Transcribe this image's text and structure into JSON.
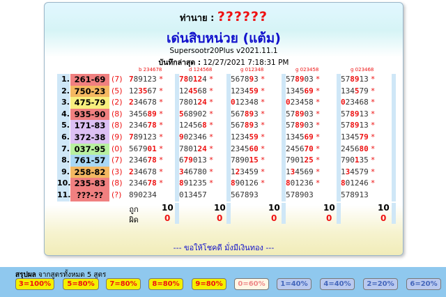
{
  "header": {
    "prophet_label": "ท่านาย :",
    "prophet_name": "??????",
    "title": "เด่นสิบหน่วย (แต้ม)",
    "version": "Supersootr20Plus v2021.11.1",
    "saved_label": "บันทึกล่าสุด :",
    "saved_value": "12/27/2021 7:18:31 PM"
  },
  "col_headers": [
    "b 234678",
    "d 124568",
    "g 012348",
    "g 023458",
    "g 023468"
  ],
  "colors": {
    "red": "#ee1111",
    "blue": "#1111cc",
    "pair_red": "#f08080",
    "pair_orange": "#f4b861",
    "pair_yellow": "#f8ef7e",
    "pair_purple": "#dcc0f4",
    "pair_green": "#b8f0a0",
    "pair_blue": "#a9d8f4"
  },
  "rows": [
    {
      "n": "1.",
      "pair": "261-69",
      "cnt": "(7)",
      "color": "#f08080",
      "sets": [
        [
          {
            "t": "7",
            "h": 1
          },
          {
            "t": "89123",
            "h": 0
          }
        ],
        [
          {
            "t": "78",
            "h": 1
          },
          {
            "t": "0",
            "h": 0
          },
          {
            "t": "12",
            "h": 1
          },
          {
            "t": "4",
            "h": 0
          }
        ],
        [
          {
            "t": "5678",
            "h": 0
          },
          {
            "t": "9",
            "h": 1
          },
          {
            "t": "3",
            "h": 0
          }
        ],
        [
          {
            "t": "57",
            "h": 0
          },
          {
            "t": "89",
            "h": 1
          },
          {
            "t": "03",
            "h": 0
          }
        ],
        [
          {
            "t": "57",
            "h": 0
          },
          {
            "t": "89",
            "h": 1
          },
          {
            "t": "13",
            "h": 0
          }
        ]
      ]
    },
    {
      "n": "2.",
      "pair": "750-23",
      "cnt": "(5)",
      "color": "#f4b861",
      "sets": [
        [
          {
            "t": "12",
            "h": 0
          },
          {
            "t": "35",
            "h": 1
          },
          {
            "t": "67",
            "h": 0
          }
        ],
        [
          {
            "t": "12",
            "h": 0
          },
          {
            "t": "45",
            "h": 1
          },
          {
            "t": "68",
            "h": 0
          }
        ],
        [
          {
            "t": "1234",
            "h": 0
          },
          {
            "t": "59",
            "h": 1
          }
        ],
        [
          {
            "t": "1345",
            "h": 0
          },
          {
            "t": "69",
            "h": 1
          }
        ],
        [
          {
            "t": "134",
            "h": 0
          },
          {
            "t": "5",
            "h": 1
          },
          {
            "t": "79",
            "h": 0
          }
        ]
      ]
    },
    {
      "n": "3.",
      "pair": "475-79",
      "cnt": "(2)",
      "color": "#f8ef7e",
      "sets": [
        [
          {
            "t": "2",
            "h": 1
          },
          {
            "t": "34678",
            "h": 0
          }
        ],
        [
          {
            "t": "7801",
            "h": 0
          },
          {
            "t": "24",
            "h": 1
          }
        ],
        [
          {
            "t": "0",
            "h": 1
          },
          {
            "t": "12348",
            "h": 0
          }
        ],
        [
          {
            "t": "0",
            "h": 1
          },
          {
            "t": "23458",
            "h": 0
          }
        ],
        [
          {
            "t": "0",
            "h": 1
          },
          {
            "t": "23468",
            "h": 0
          }
        ]
      ]
    },
    {
      "n": "4.",
      "pair": "935-90",
      "cnt": "(8)",
      "color": "#f08080",
      "sets": [
        [
          {
            "t": "3456",
            "h": 0
          },
          {
            "t": "89",
            "h": 1
          }
        ],
        [
          {
            "t": "5",
            "h": 1
          },
          {
            "t": "68902",
            "h": 0
          }
        ],
        [
          {
            "t": "567",
            "h": 0
          },
          {
            "t": "89",
            "h": 1
          },
          {
            "t": "3",
            "h": 0
          }
        ],
        [
          {
            "t": "57",
            "h": 0
          },
          {
            "t": "89",
            "h": 1
          },
          {
            "t": "03",
            "h": 0
          }
        ],
        [
          {
            "t": "57",
            "h": 0
          },
          {
            "t": "89",
            "h": 1
          },
          {
            "t": "13",
            "h": 0
          }
        ]
      ]
    },
    {
      "n": "5.",
      "pair": "171-83",
      "cnt": "(8)",
      "color": "#dcc0f4",
      "sets": [
        [
          {
            "t": "2346",
            "h": 0
          },
          {
            "t": "78",
            "h": 1
          }
        ],
        [
          {
            "t": "12456",
            "h": 0
          },
          {
            "t": "8",
            "h": 1
          }
        ],
        [
          {
            "t": "567",
            "h": 0
          },
          {
            "t": "89",
            "h": 1
          },
          {
            "t": "3",
            "h": 0
          }
        ],
        [
          {
            "t": "57",
            "h": 0
          },
          {
            "t": "89",
            "h": 1
          },
          {
            "t": "03",
            "h": 0
          }
        ],
        [
          {
            "t": "57",
            "h": 0
          },
          {
            "t": "89",
            "h": 1
          },
          {
            "t": "13",
            "h": 0
          }
        ]
      ]
    },
    {
      "n": "6.",
      "pair": "372-38",
      "cnt": "(9)",
      "color": "#dcc0f4",
      "sets": [
        [
          {
            "t": "7",
            "h": 1
          },
          {
            "t": "89123",
            "h": 0
          }
        ],
        [
          {
            "t": "9",
            "h": 1
          },
          {
            "t": "02346",
            "h": 0
          }
        ],
        [
          {
            "t": "1234",
            "h": 0
          },
          {
            "t": "59",
            "h": 1
          }
        ],
        [
          {
            "t": "1345",
            "h": 0
          },
          {
            "t": "69",
            "h": 1
          }
        ],
        [
          {
            "t": "1345",
            "h": 0
          },
          {
            "t": "79",
            "h": 1
          }
        ]
      ]
    },
    {
      "n": "7.",
      "pair": "037-95",
      "cnt": "(0)",
      "color": "#b8f0a0",
      "sets": [
        [
          {
            "t": "5679",
            "h": 0
          },
          {
            "t": "01",
            "h": 1
          }
        ],
        [
          {
            "t": "7801",
            "h": 0
          },
          {
            "t": "24",
            "h": 1
          }
        ],
        [
          {
            "t": "2345",
            "h": 0
          },
          {
            "t": "60",
            "h": 1
          }
        ],
        [
          {
            "t": "2456",
            "h": 0
          },
          {
            "t": "70",
            "h": 1
          }
        ],
        [
          {
            "t": "2456",
            "h": 0
          },
          {
            "t": "80",
            "h": 1
          }
        ]
      ]
    },
    {
      "n": "8.",
      "pair": "761-57",
      "cnt": "(7)",
      "color": "#a9d8f4",
      "sets": [
        [
          {
            "t": "2346",
            "h": 0
          },
          {
            "t": "78",
            "h": 1
          }
        ],
        [
          {
            "t": "6",
            "h": 0
          },
          {
            "t": "79",
            "h": 1
          },
          {
            "t": "013",
            "h": 0
          }
        ],
        [
          {
            "t": "7890",
            "h": 0
          },
          {
            "t": "15",
            "h": 1
          }
        ],
        [
          {
            "t": "7901",
            "h": 0
          },
          {
            "t": "25",
            "h": 1
          }
        ],
        [
          {
            "t": "790",
            "h": 0
          },
          {
            "t": "1",
            "h": 1
          },
          {
            "t": "35",
            "h": 0
          }
        ]
      ]
    },
    {
      "n": "9.",
      "pair": "258-82",
      "cnt": "(3)",
      "color": "#f4b861",
      "sets": [
        [
          {
            "t": "2",
            "h": 1
          },
          {
            "t": "34678",
            "h": 0
          }
        ],
        [
          {
            "t": "3",
            "h": 1
          },
          {
            "t": "46780",
            "h": 0
          }
        ],
        [
          {
            "t": "1",
            "h": 0
          },
          {
            "t": "2",
            "h": 1
          },
          {
            "t": "3459",
            "h": 0
          }
        ],
        [
          {
            "t": "1",
            "h": 0
          },
          {
            "t": "3",
            "h": 1
          },
          {
            "t": "4569",
            "h": 0
          }
        ],
        [
          {
            "t": "1",
            "h": 0
          },
          {
            "t": "3",
            "h": 1
          },
          {
            "t": "4579",
            "h": 0
          }
        ]
      ]
    },
    {
      "n": "10.",
      "pair": "235-83",
      "cnt": "(8)",
      "color": "#f08080",
      "sets": [
        [
          {
            "t": "2346",
            "h": 0
          },
          {
            "t": "78",
            "h": 1
          }
        ],
        [
          {
            "t": "8",
            "h": 1
          },
          {
            "t": "91235",
            "h": 0
          }
        ],
        [
          {
            "t": "8",
            "h": 1
          },
          {
            "t": "90126",
            "h": 0
          }
        ],
        [
          {
            "t": "8",
            "h": 1
          },
          {
            "t": "01236",
            "h": 0
          }
        ],
        [
          {
            "t": "8",
            "h": 1
          },
          {
            "t": "01246",
            "h": 0
          }
        ]
      ]
    },
    {
      "n": "11.",
      "pair": "???-??",
      "cnt": "(?)",
      "color": "#f08080",
      "nostar": true,
      "sets": [
        [
          {
            "t": "890234",
            "h": 0
          }
        ],
        [
          {
            "t": "013457",
            "h": 0
          }
        ],
        [
          {
            "t": "567893",
            "h": 0
          }
        ],
        [
          {
            "t": "578903",
            "h": 0
          }
        ],
        [
          {
            "t": "578913",
            "h": 0
          }
        ]
      ]
    }
  ],
  "totals": {
    "hit_label": "ถูก",
    "miss_label": "ผิด",
    "hits": [
      "10",
      "10",
      "10",
      "10",
      "10"
    ],
    "misses": [
      "0",
      "0",
      "0",
      "0",
      "0"
    ]
  },
  "star": "*",
  "blessing": "--- ขอให้โชคดี มั่งมีเงินทอง ---",
  "summary": {
    "label": "สรุปผล",
    "sub": "จากสูตรทั้งหมด 5 สูตร",
    "pills": [
      {
        "label": "3=100%",
        "bg": "#f4f000",
        "fg": "#ee1111"
      },
      {
        "label": "5=80%",
        "bg": "#f4f000",
        "fg": "#ee1111"
      },
      {
        "label": "7=80%",
        "bg": "#f4f000",
        "fg": "#ee1111"
      },
      {
        "label": "8=80%",
        "bg": "#f4f000",
        "fg": "#ee1111"
      },
      {
        "label": "9=80%",
        "bg": "#f4f000",
        "fg": "#ee1111"
      },
      {
        "label": "0=60%",
        "bg": "#fff7e6",
        "fg": "#ee8888"
      },
      {
        "label": "1=40%",
        "bg": "#b9c9ef",
        "fg": "#4466bb"
      },
      {
        "label": "4=40%",
        "bg": "#b9c9ef",
        "fg": "#4466bb"
      },
      {
        "label": "2=20%",
        "bg": "#b9c9ef",
        "fg": "#4466bb"
      },
      {
        "label": "6=20%",
        "bg": "#b9c9ef",
        "fg": "#4466bb"
      }
    ]
  }
}
